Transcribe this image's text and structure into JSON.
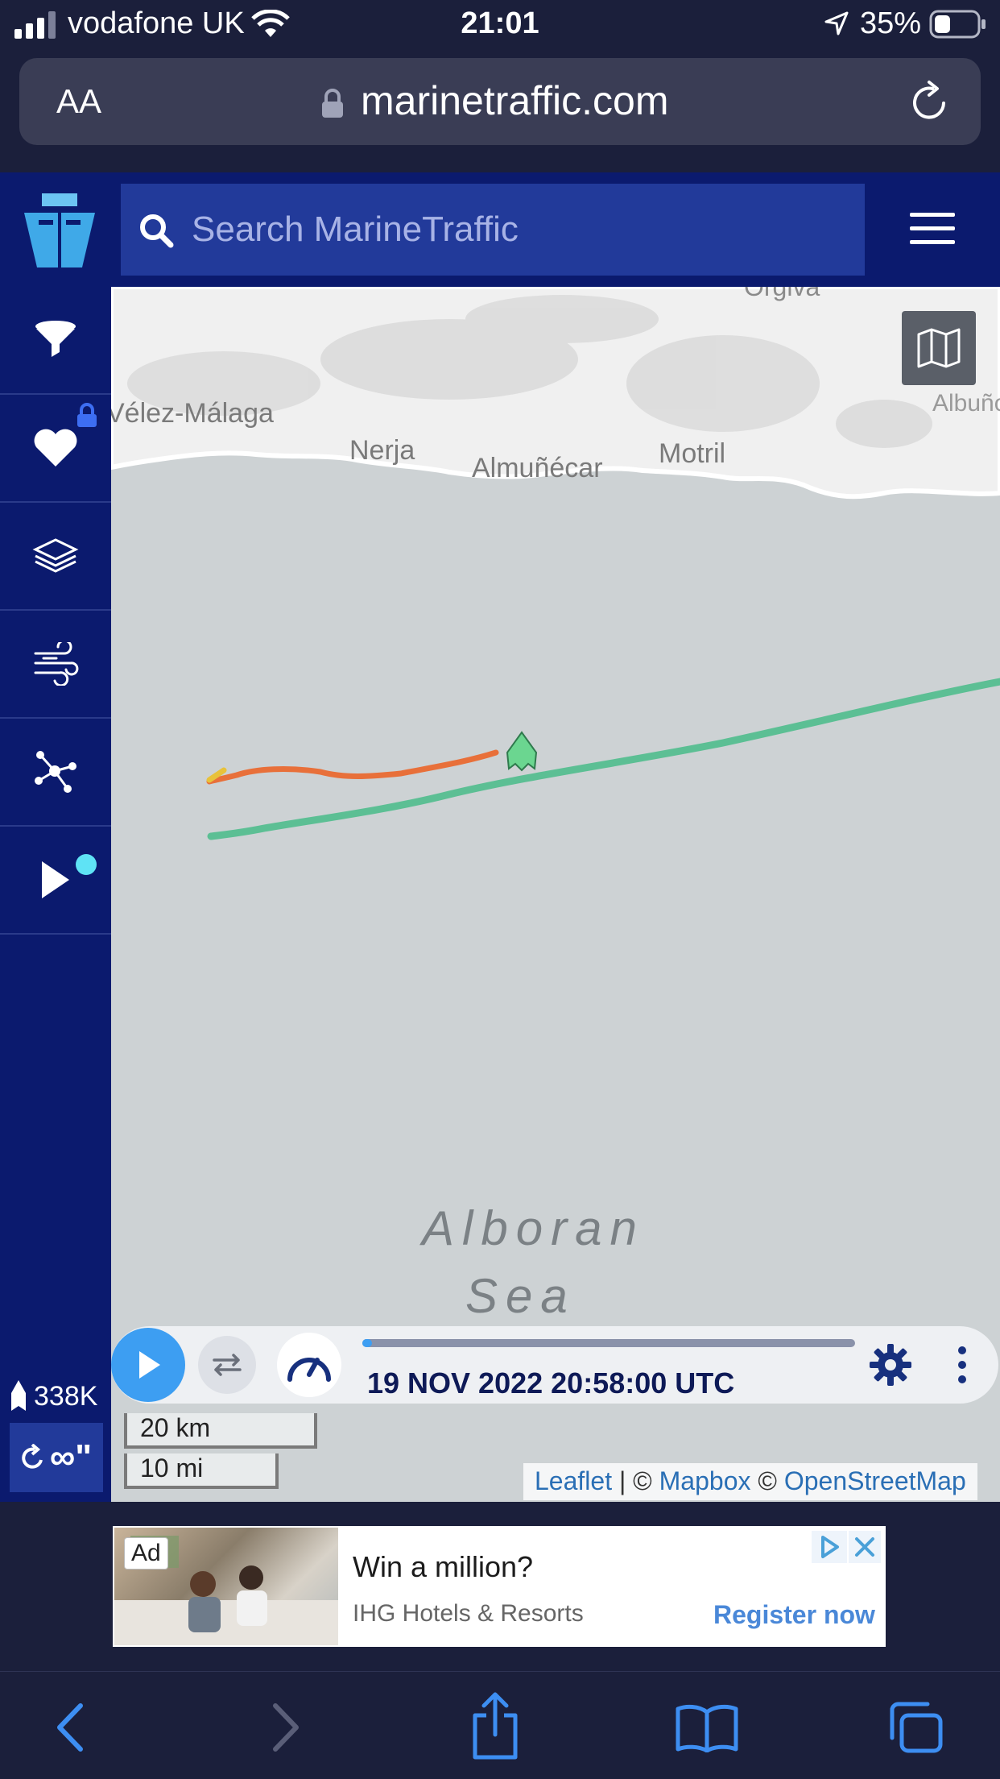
{
  "status_bar": {
    "carrier": "vodafone UK",
    "time": "21:01",
    "battery": "35%"
  },
  "browser": {
    "text_size_label": "AA",
    "domain": "marinetraffic.com"
  },
  "header": {
    "search_placeholder": "Search MarineTraffic"
  },
  "sidebar": {
    "vessel_count": "338K",
    "refresh_label": "∞\""
  },
  "map": {
    "places": [
      "Vélez-Málaga",
      "Nerja",
      "Almuñécar",
      "Motril",
      "Órgiva",
      "Albuñol"
    ],
    "sea_label_line1": "Alboran",
    "sea_label_line2": "Sea"
  },
  "playback": {
    "timestamp": "19 NOV 2022 20:58:00 UTC",
    "progress": 1.0
  },
  "scale": {
    "km": "20 km",
    "mi": "10 mi"
  },
  "attribution": {
    "leaflet": "Leaflet",
    "sep1": " | © ",
    "mapbox": "Mapbox",
    "sep2": " © ",
    "osm": "OpenStreetMap"
  },
  "ad": {
    "badge": "Ad",
    "title": "Win a million?",
    "brand": "IHG Hotels & Resorts",
    "cta": "Register now"
  },
  "colors": {
    "header_bg": "#0b1a6e",
    "search_bg": "#223a9a",
    "accent_blue": "#3d9ef2",
    "track_green": "#5cbf94",
    "track_orange": "#e8703a",
    "notify_dot": "#5fe3f5"
  }
}
